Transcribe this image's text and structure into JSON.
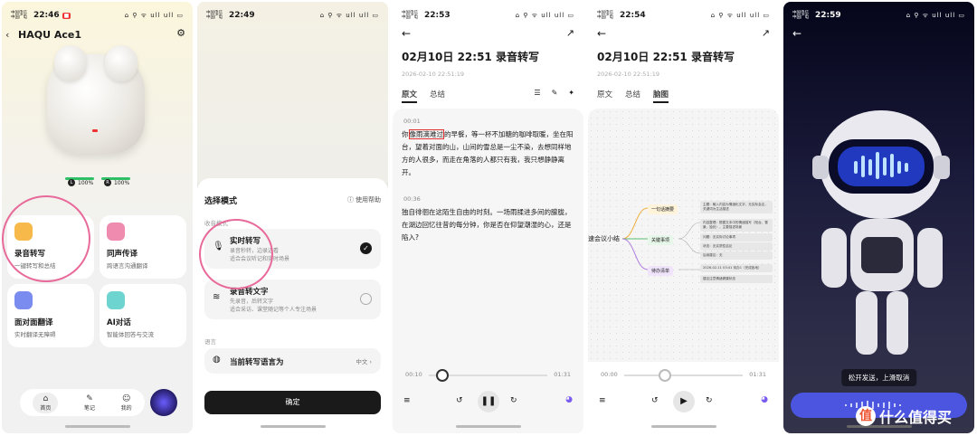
{
  "p1": {
    "carrier": "中国电信\n中国广电",
    "time": "22:46",
    "status_icons": "⌂ ⚲ ᯤ ull ull ▭",
    "device_name": "HAQU Ace1",
    "battery_left": "100%",
    "battery_right": "100%",
    "battery_left_tag": "L",
    "battery_right_tag": "R",
    "cards": [
      {
        "title": "录音转写",
        "sub": "一键转写和总结"
      },
      {
        "title": "同声传译",
        "sub": "跨语言沟通翻译"
      },
      {
        "title": "面对面翻译",
        "sub": "实时翻译无障碍"
      },
      {
        "title": "AI对话",
        "sub": "智能体回答与交流"
      }
    ],
    "nav": [
      "首页",
      "笔记",
      "我的"
    ],
    "colors": {
      "ring": "#e86a9a",
      "battery_bar": "#2fbf67"
    }
  },
  "p2": {
    "carrier": "中国电信\n中国广电",
    "time": "22:49",
    "status_icons": "⌂ ⚲ ᯤ ull ull ▭",
    "title": "选择模式",
    "help": "使用帮助",
    "section1": "收音模式",
    "opt1_title": "实时转写",
    "opt1_sub": "录音秒转，边录边看\n适合会议听记和实时场景",
    "opt2_title": "录音转文字",
    "opt2_sub": "先录音，后转文字\n适合采访、课堂随记等个人专注场景",
    "section2": "语言",
    "lang_label": "当前转写语言为",
    "lang_value": "中文 ›",
    "confirm": "确定"
  },
  "p3": {
    "carrier": "中国电信\n中国广电",
    "time": "22:53",
    "status_icons": "⌂ ⚲ ᯤ ull ull ▭",
    "title": "02月10日 22:51 录音转写",
    "date": "2026-02-10 22:51:19",
    "tabs": [
      "原文",
      "总结"
    ],
    "ts1": "00:01",
    "para1_a": "你",
    "para1_hl": "像雨滴难过",
    "para1_b": "的早餐，等一杯不加糖的咖啡取暖，坐在阳台，望着对面的山，山间的雪总是一尘不染，去想同样地方的人很多，而走在角落的人都只有我，我只想静静离开。",
    "ts2": "00:36",
    "para2": "独自徘徊在这陌生自由的时刻。一场雨揉进多间的朦胧，在湖边回忆往昔的每分钟，你是否在仰望潮湿的心，还是陷入?",
    "pos": "00:10",
    "dur": "01:31"
  },
  "p4": {
    "carrier": "中国电信\n中国广电",
    "time": "22:54",
    "status_icons": "⌂ ⚲ ᯤ ull ull ▭",
    "title": "02月10日 22:51 录音转写",
    "date": "2026-02-10 22:51:19",
    "tabs": [
      "原文",
      "总结",
      "脑图"
    ],
    "root": "速会议小结",
    "n1": "一句话摘要",
    "n2": "关键事项",
    "n3": "待办清单",
    "leaves": [
      "主题：输入内容为情绪化文字，无实际会议，关键词为生活描述",
      "内容整理：根据文本中的情绪描写（阳台、雪景、独处），主要描述场景",
      "问题：无实际讨论事项",
      "状态：无实质性结论",
      "后续建议：无",
      "2026-02-11 03:41 待办1（完成各地）",
      "建议注意情绪健康状态"
    ],
    "pos": "00:00",
    "dur": "01:31"
  },
  "p5": {
    "carrier": "中国电信\n中国广电",
    "time": "22:59",
    "status_icons": "⌂ ⚲ ᯤ ull ull ▭",
    "hint": "松开发送，上滑取消",
    "colors": {
      "talk": "#4b55e0",
      "visor": "#2a4dff"
    }
  },
  "watermark": {
    "logo": "值",
    "text": "什么值得买"
  }
}
